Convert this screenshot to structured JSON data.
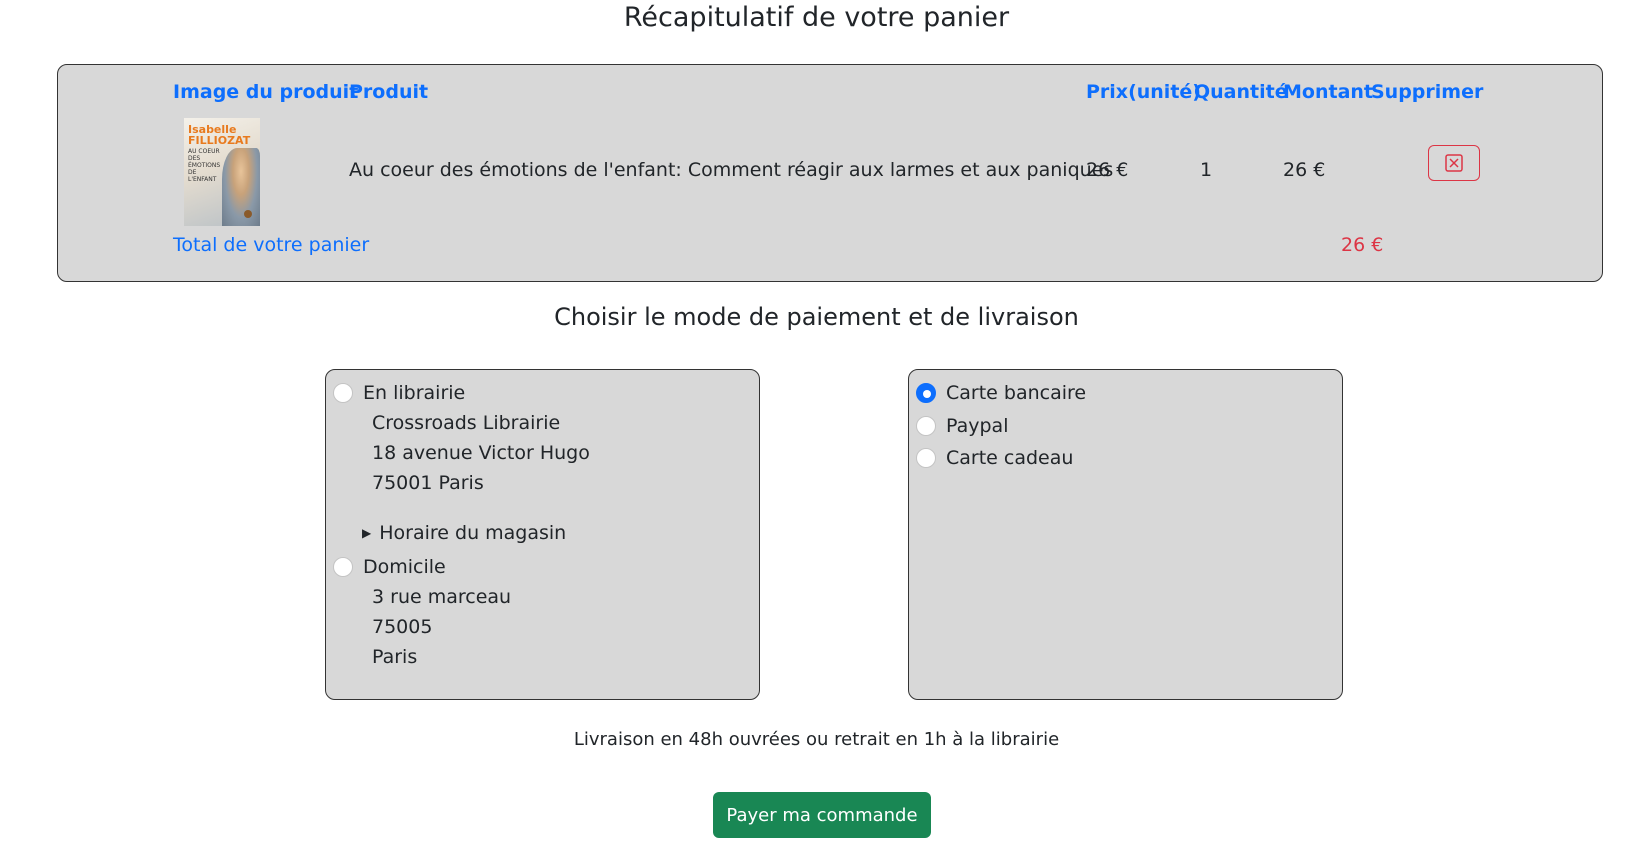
{
  "page_title": "Récapitulatif de votre panier",
  "cart": {
    "headers": {
      "image": "Image du produit",
      "product": "Produit",
      "unit_price": "Prix(unité)",
      "quantity": "Quantité",
      "amount": "Montant",
      "delete": "Supprimer"
    },
    "items": [
      {
        "cover_author": "Isabelle FILLIOZAT",
        "cover_title": "AU COEUR DES ÉMOTIONS DE L'ENFANT",
        "name": "Au coeur des émotions de l'enfant: Comment réagir aux larmes et aux paniques",
        "unit_price": "26 €",
        "quantity": "1",
        "amount": "26 €",
        "delete_icon": "x-square-icon"
      }
    ],
    "total_label": "Total de votre panier",
    "total_value": "26 €"
  },
  "options_title": "Choisir le mode de paiement et de livraison",
  "delivery": {
    "store": {
      "label": "En librairie",
      "selected": false,
      "address": [
        "Crossroads Librairie",
        "18 avenue Victor Hugo",
        "75001 Paris"
      ],
      "hours_label": "Horaire du magasin"
    },
    "home": {
      "label": "Domicile",
      "selected": false,
      "address": [
        "3 rue marceau",
        "75005",
        "Paris"
      ]
    }
  },
  "payment": {
    "options": [
      {
        "label": "Carte bancaire",
        "selected": true
      },
      {
        "label": "Paypal",
        "selected": false
      },
      {
        "label": "Carte cadeau",
        "selected": false
      }
    ]
  },
  "delivery_note": "Livraison en 48h ouvrées ou retrait en 1h à la librairie",
  "pay_button": "Payer ma commande",
  "colors": {
    "link_blue": "#0d6efd",
    "danger_red": "#dc3545",
    "success_green": "#198754",
    "panel_gray": "#d8d8d8"
  }
}
